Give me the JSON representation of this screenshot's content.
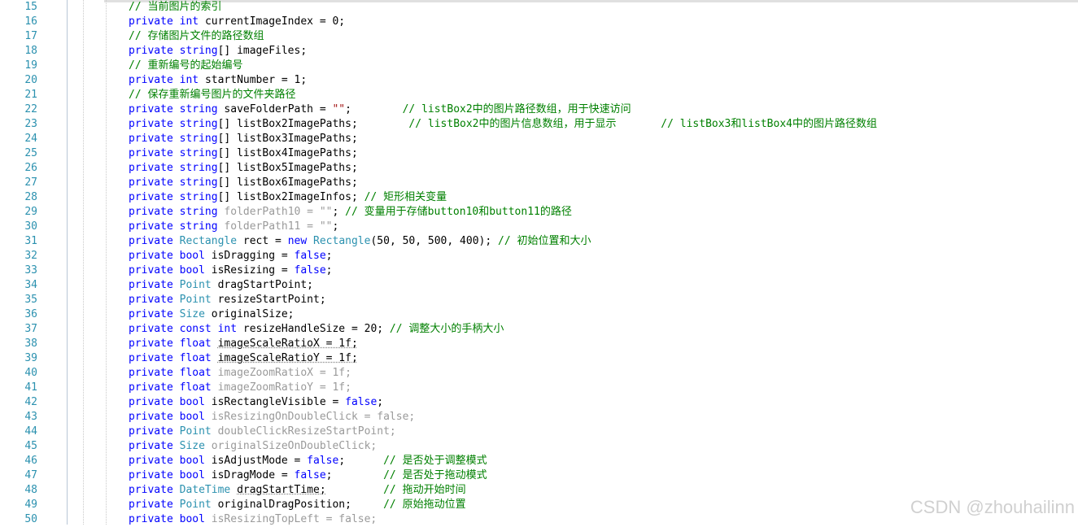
{
  "editor": {
    "lines": [
      {
        "n": "15",
        "segs": [
          {
            "t": "// 当前图片的索引",
            "c": "cm"
          }
        ]
      },
      {
        "n": "16",
        "segs": [
          {
            "t": "private ",
            "c": "kw"
          },
          {
            "t": "int ",
            "c": "kw"
          },
          {
            "t": "currentImageIndex = 0;",
            "c": "pl"
          }
        ]
      },
      {
        "n": "17",
        "segs": [
          {
            "t": "// 存储图片文件的路径数组",
            "c": "cm"
          }
        ]
      },
      {
        "n": "18",
        "segs": [
          {
            "t": "private ",
            "c": "kw"
          },
          {
            "t": "string",
            "c": "kw"
          },
          {
            "t": "[] imageFiles;",
            "c": "pl"
          }
        ]
      },
      {
        "n": "19",
        "segs": [
          {
            "t": "// 重新编号的起始编号",
            "c": "cm"
          }
        ]
      },
      {
        "n": "20",
        "segs": [
          {
            "t": "private ",
            "c": "kw"
          },
          {
            "t": "int ",
            "c": "kw"
          },
          {
            "t": "startNumber = 1;",
            "c": "pl"
          }
        ]
      },
      {
        "n": "21",
        "segs": [
          {
            "t": "// 保存重新编号图片的文件夹路径",
            "c": "cm"
          }
        ]
      },
      {
        "n": "22",
        "segs": [
          {
            "t": "private ",
            "c": "kw"
          },
          {
            "t": "string ",
            "c": "kw"
          },
          {
            "t": "saveFolderPath = ",
            "c": "pl"
          },
          {
            "t": "\"\"",
            "c": "st"
          },
          {
            "t": ";        ",
            "c": "pl"
          },
          {
            "t": "// listBox2中的图片路径数组，用于快速访问",
            "c": "cm"
          }
        ]
      },
      {
        "n": "23",
        "segs": [
          {
            "t": "private ",
            "c": "kw"
          },
          {
            "t": "string",
            "c": "kw"
          },
          {
            "t": "[] listBox2ImagePaths;        ",
            "c": "pl"
          },
          {
            "t": "// listBox2中的图片信息数组，用于显示       // listBox3和listBox4中的图片路径数组",
            "c": "cm"
          }
        ]
      },
      {
        "n": "24",
        "segs": [
          {
            "t": "private ",
            "c": "kw"
          },
          {
            "t": "string",
            "c": "kw"
          },
          {
            "t": "[] listBox3ImagePaths;",
            "c": "pl"
          }
        ]
      },
      {
        "n": "25",
        "segs": [
          {
            "t": "private ",
            "c": "kw"
          },
          {
            "t": "string",
            "c": "kw"
          },
          {
            "t": "[] listBox4ImagePaths;",
            "c": "pl"
          }
        ]
      },
      {
        "n": "26",
        "segs": [
          {
            "t": "private ",
            "c": "kw"
          },
          {
            "t": "string",
            "c": "kw"
          },
          {
            "t": "[] listBox5ImagePaths;",
            "c": "pl"
          }
        ]
      },
      {
        "n": "27",
        "segs": [
          {
            "t": "private ",
            "c": "kw"
          },
          {
            "t": "string",
            "c": "kw"
          },
          {
            "t": "[] listBox6ImagePaths;",
            "c": "pl"
          }
        ]
      },
      {
        "n": "28",
        "segs": [
          {
            "t": "private ",
            "c": "kw"
          },
          {
            "t": "string",
            "c": "kw"
          },
          {
            "t": "[] listBox2ImageInfos; ",
            "c": "pl"
          },
          {
            "t": "// 矩形相关变量",
            "c": "cm"
          }
        ]
      },
      {
        "n": "29",
        "segs": [
          {
            "t": "private ",
            "c": "kw"
          },
          {
            "t": "string ",
            "c": "kw"
          },
          {
            "t": "folderPath10 = \"\"",
            "c": "fd"
          },
          {
            "t": "; ",
            "c": "pl"
          },
          {
            "t": "// 变量用于存储button10和button11的路径",
            "c": "cm"
          }
        ]
      },
      {
        "n": "30",
        "segs": [
          {
            "t": "private ",
            "c": "kw"
          },
          {
            "t": "string ",
            "c": "kw"
          },
          {
            "t": "folderPath11 = \"\"",
            "c": "fd"
          },
          {
            "t": ";",
            "c": "pl"
          }
        ]
      },
      {
        "n": "31",
        "segs": [
          {
            "t": "private ",
            "c": "kw"
          },
          {
            "t": "Rectangle ",
            "c": "ty"
          },
          {
            "t": "rect = ",
            "c": "pl"
          },
          {
            "t": "new ",
            "c": "kw"
          },
          {
            "t": "Rectangle",
            "c": "ty"
          },
          {
            "t": "(50, 50, 500, 400); ",
            "c": "pl"
          },
          {
            "t": "// 初始位置和大小",
            "c": "cm"
          }
        ]
      },
      {
        "n": "32",
        "segs": [
          {
            "t": "private ",
            "c": "kw"
          },
          {
            "t": "bool ",
            "c": "kw"
          },
          {
            "t": "isDragging = ",
            "c": "pl"
          },
          {
            "t": "false",
            "c": "kw"
          },
          {
            "t": ";",
            "c": "pl"
          }
        ]
      },
      {
        "n": "33",
        "segs": [
          {
            "t": "private ",
            "c": "kw"
          },
          {
            "t": "bool ",
            "c": "kw"
          },
          {
            "t": "isResizing = ",
            "c": "pl"
          },
          {
            "t": "false",
            "c": "kw"
          },
          {
            "t": ";",
            "c": "pl"
          }
        ]
      },
      {
        "n": "34",
        "segs": [
          {
            "t": "private ",
            "c": "kw"
          },
          {
            "t": "Point ",
            "c": "ty"
          },
          {
            "t": "dragStartPoint;",
            "c": "pl"
          }
        ]
      },
      {
        "n": "35",
        "segs": [
          {
            "t": "private ",
            "c": "kw"
          },
          {
            "t": "Point ",
            "c": "ty"
          },
          {
            "t": "resizeStartPoint;",
            "c": "pl"
          }
        ]
      },
      {
        "n": "36",
        "segs": [
          {
            "t": "private ",
            "c": "kw"
          },
          {
            "t": "Size ",
            "c": "ty"
          },
          {
            "t": "originalSize;",
            "c": "pl"
          }
        ]
      },
      {
        "n": "37",
        "segs": [
          {
            "t": "private ",
            "c": "kw"
          },
          {
            "t": "const ",
            "c": "kw"
          },
          {
            "t": "int ",
            "c": "kw"
          },
          {
            "t": "resizeHandleSize = 20; ",
            "c": "pl"
          },
          {
            "t": "// 调整大小的手柄大小",
            "c": "cm"
          }
        ]
      },
      {
        "n": "38",
        "segs": [
          {
            "t": "private ",
            "c": "kw"
          },
          {
            "t": "float ",
            "c": "kw"
          },
          {
            "t": "imageScaleRatioX = 1f;",
            "c": "un"
          }
        ]
      },
      {
        "n": "39",
        "segs": [
          {
            "t": "private ",
            "c": "kw"
          },
          {
            "t": "float ",
            "c": "kw"
          },
          {
            "t": "imageScaleRatioY = 1f;",
            "c": "un"
          }
        ]
      },
      {
        "n": "40",
        "segs": [
          {
            "t": "private ",
            "c": "kw"
          },
          {
            "t": "float ",
            "c": "kw"
          },
          {
            "t": "imageZoomRatioX = 1f;",
            "c": "fd"
          }
        ]
      },
      {
        "n": "41",
        "segs": [
          {
            "t": "private ",
            "c": "kw"
          },
          {
            "t": "float ",
            "c": "kw"
          },
          {
            "t": "imageZoomRatioY = 1f;",
            "c": "fd"
          }
        ]
      },
      {
        "n": "42",
        "segs": [
          {
            "t": "private ",
            "c": "kw"
          },
          {
            "t": "bool ",
            "c": "kw"
          },
          {
            "t": "isRectangleVisible = ",
            "c": "pl"
          },
          {
            "t": "false",
            "c": "kw"
          },
          {
            "t": ";",
            "c": "pl"
          }
        ]
      },
      {
        "n": "43",
        "segs": [
          {
            "t": "private ",
            "c": "kw"
          },
          {
            "t": "bool ",
            "c": "kw"
          },
          {
            "t": "isResizingOnDoubleClick = false;",
            "c": "fd"
          }
        ]
      },
      {
        "n": "44",
        "segs": [
          {
            "t": "private ",
            "c": "kw"
          },
          {
            "t": "Point ",
            "c": "ty"
          },
          {
            "t": "doubleClickResizeStartPoint;",
            "c": "fd"
          }
        ]
      },
      {
        "n": "45",
        "segs": [
          {
            "t": "private ",
            "c": "kw"
          },
          {
            "t": "Size ",
            "c": "ty"
          },
          {
            "t": "originalSizeOnDoubleClick;",
            "c": "fd"
          }
        ]
      },
      {
        "n": "46",
        "segs": [
          {
            "t": "private ",
            "c": "kw"
          },
          {
            "t": "bool ",
            "c": "kw"
          },
          {
            "t": "isAdjustMode = ",
            "c": "pl"
          },
          {
            "t": "false",
            "c": "kw"
          },
          {
            "t": ";      ",
            "c": "pl"
          },
          {
            "t": "// 是否处于调整模式",
            "c": "cm"
          }
        ]
      },
      {
        "n": "47",
        "segs": [
          {
            "t": "private ",
            "c": "kw"
          },
          {
            "t": "bool ",
            "c": "kw"
          },
          {
            "t": "isDragMode = ",
            "c": "pl"
          },
          {
            "t": "false",
            "c": "kw"
          },
          {
            "t": ";        ",
            "c": "pl"
          },
          {
            "t": "// 是否处于拖动模式",
            "c": "cm"
          }
        ]
      },
      {
        "n": "48",
        "segs": [
          {
            "t": "private ",
            "c": "kw"
          },
          {
            "t": "DateTime ",
            "c": "ty"
          },
          {
            "t": "dragStartTime;",
            "c": "un"
          },
          {
            "t": "         ",
            "c": "pl"
          },
          {
            "t": "// 拖动开始时间",
            "c": "cm"
          }
        ]
      },
      {
        "n": "49",
        "segs": [
          {
            "t": "private ",
            "c": "kw"
          },
          {
            "t": "Point ",
            "c": "ty"
          },
          {
            "t": "originalDragPosition;",
            "c": "pl"
          },
          {
            "t": "     ",
            "c": "pl"
          },
          {
            "t": "// 原始拖动位置",
            "c": "cm"
          }
        ]
      },
      {
        "n": "50",
        "segs": [
          {
            "t": "private ",
            "c": "kw"
          },
          {
            "t": "bool ",
            "c": "kw"
          },
          {
            "t": "isResizingTopLeft = false;",
            "c": "fd"
          }
        ]
      }
    ]
  },
  "colors": {
    "keyword": "#0000ff",
    "type": "#2b91af",
    "comment": "#008000",
    "string": "#a31515",
    "line_number": "#2b91af",
    "faded": "#9a9a9a"
  },
  "watermark": "CSDN @zhouhailinn"
}
